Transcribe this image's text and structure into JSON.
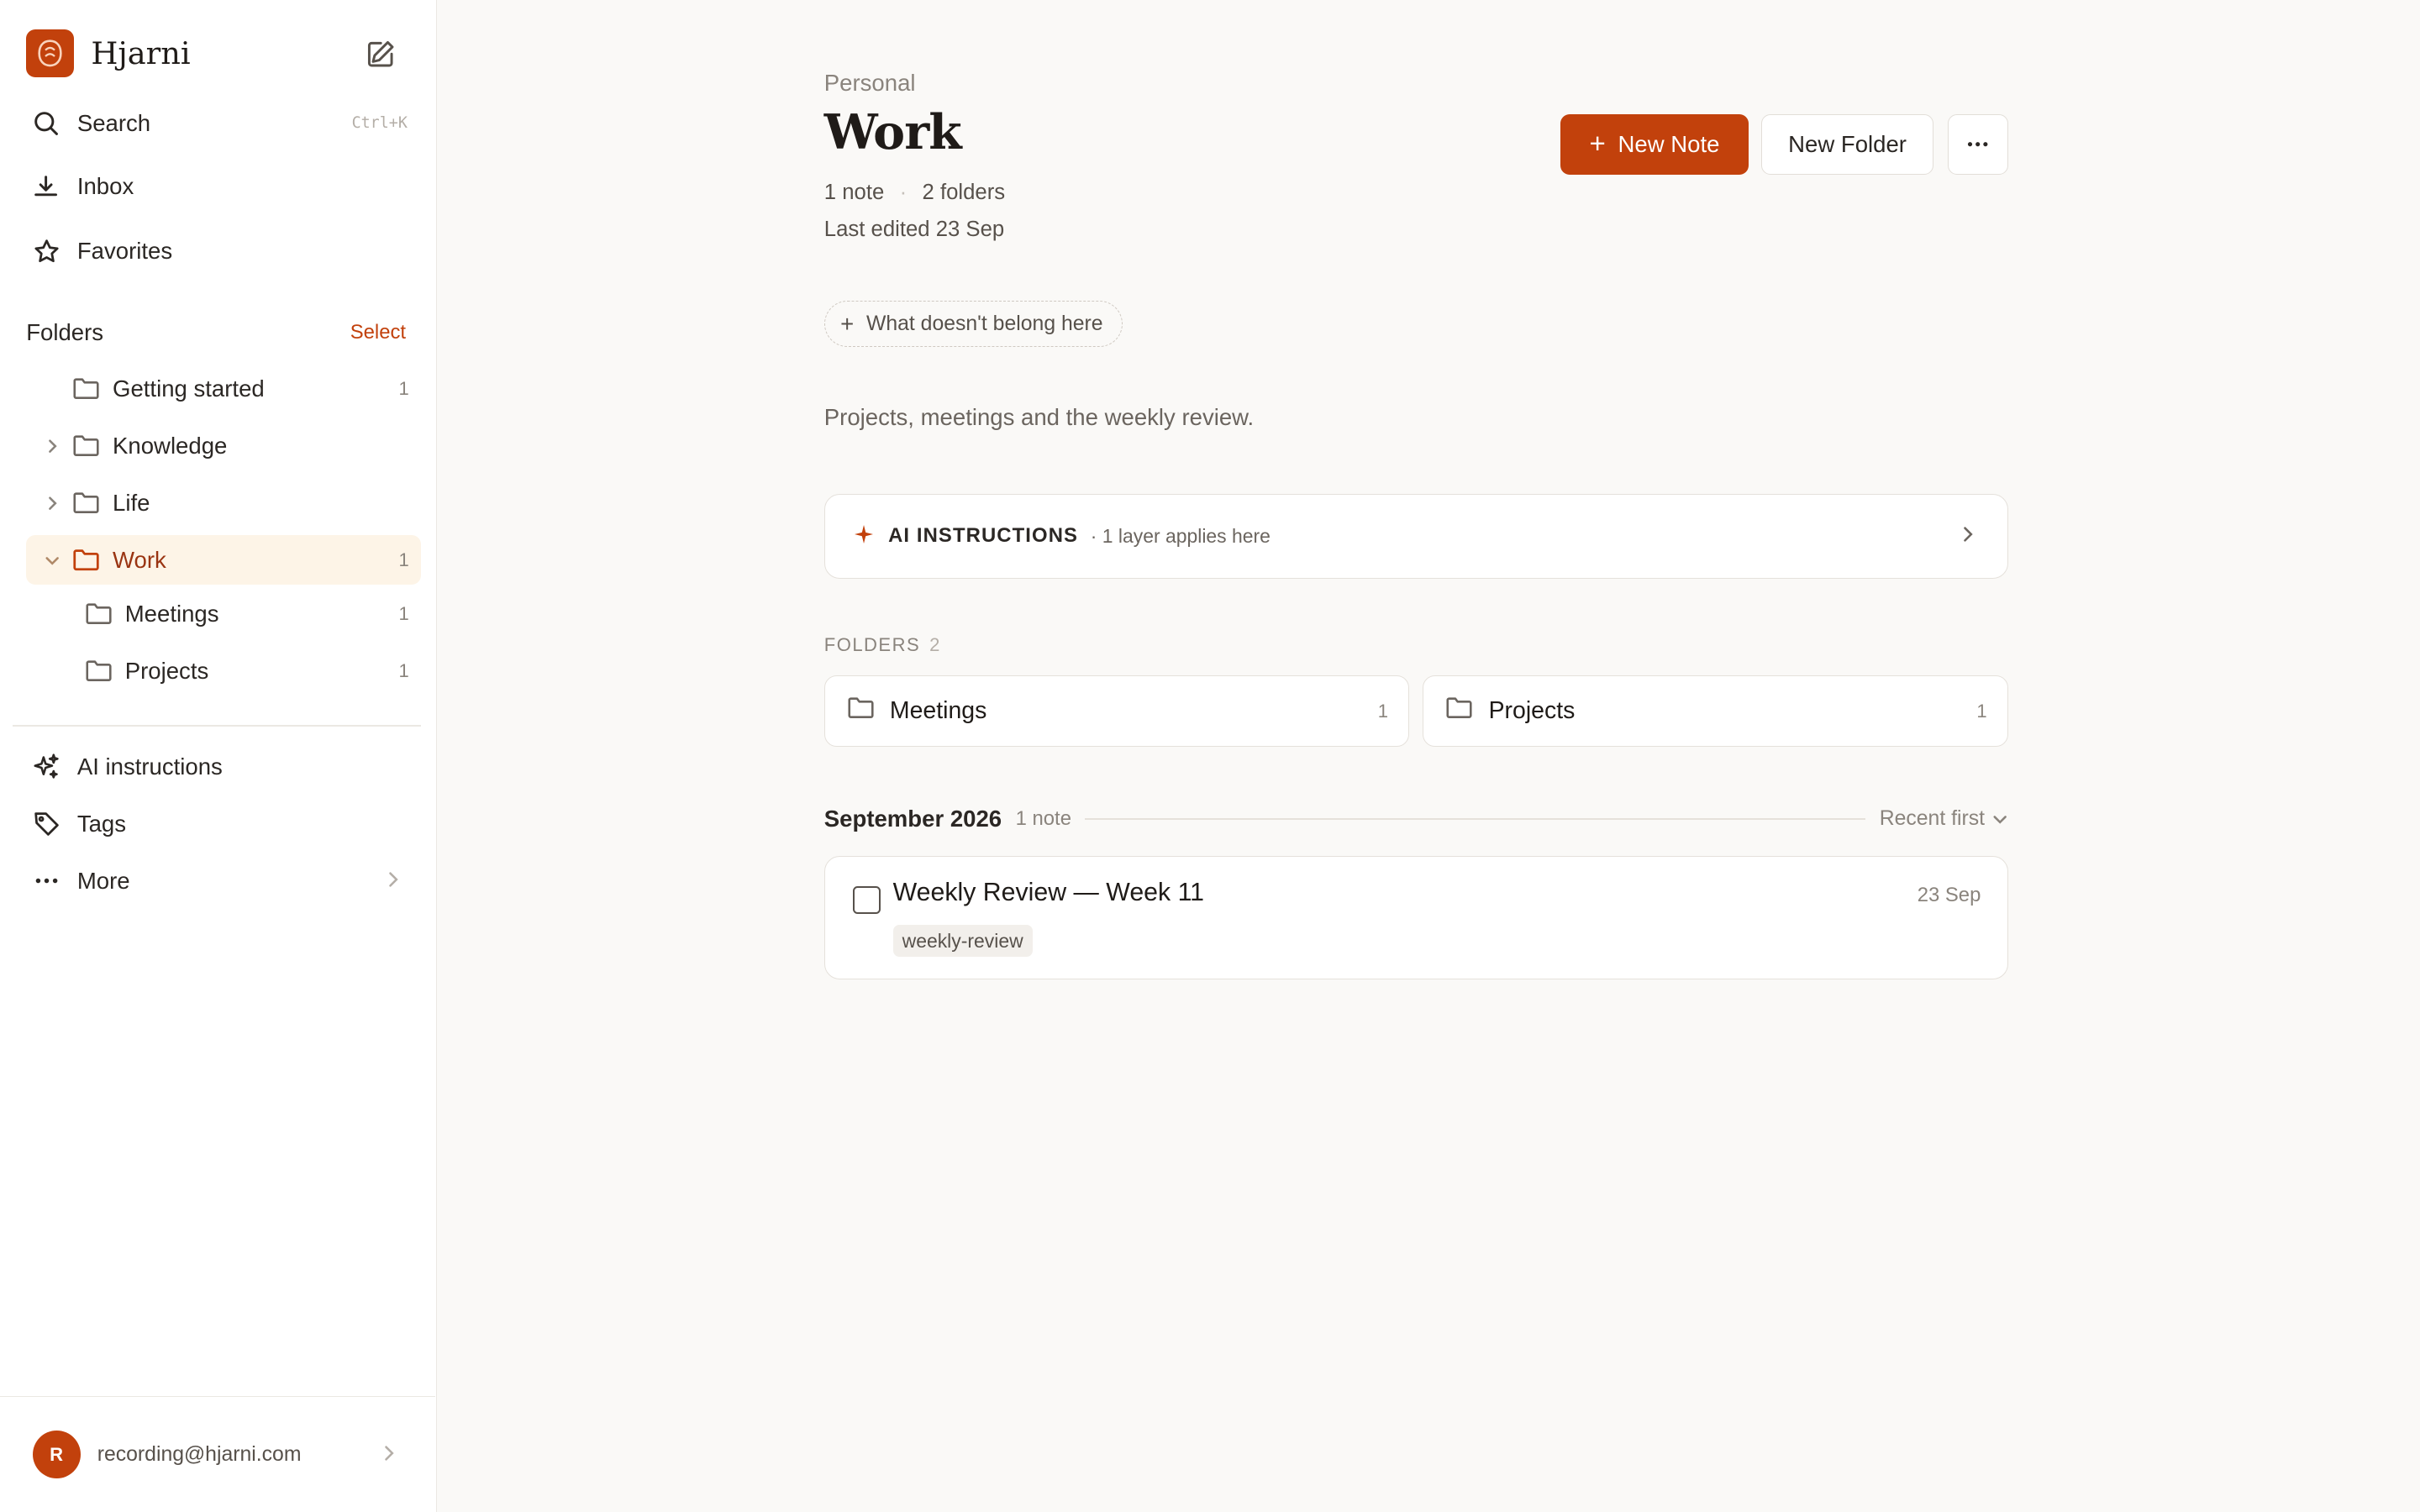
{
  "brand": {
    "name": "Hjarni"
  },
  "nav": {
    "search": {
      "label": "Search",
      "shortcut": "Ctrl+K"
    },
    "inbox": {
      "label": "Inbox"
    },
    "favorites": {
      "label": "Favorites"
    }
  },
  "folders_section": {
    "title": "Folders",
    "select_label": "Select",
    "items": [
      {
        "label": "Getting started",
        "count": "1"
      },
      {
        "label": "Knowledge",
        "count": ""
      },
      {
        "label": "Life",
        "count": ""
      },
      {
        "label": "Work",
        "count": "1"
      },
      {
        "label": "Meetings",
        "count": "1"
      },
      {
        "label": "Projects",
        "count": "1"
      }
    ]
  },
  "bottom_nav": {
    "ai": {
      "label": "AI instructions"
    },
    "tags": {
      "label": "Tags"
    },
    "more": {
      "label": "More"
    }
  },
  "account": {
    "initial": "R",
    "email": "recording@hjarni.com"
  },
  "main": {
    "breadcrumb": "Personal",
    "title": "Work",
    "meta": {
      "notes": "1 note",
      "folders": "2 folders"
    },
    "last_edited": "Last edited 23 Sep",
    "actions": {
      "new_note": "New Note",
      "new_folder": "New Folder"
    },
    "exclude_pill": "What doesn't belong here",
    "description": "Projects, meetings and the weekly review.",
    "ai_card": {
      "title": "AI INSTRUCTIONS",
      "subtitle": "· 1 layer applies here"
    },
    "folders_header": {
      "label": "FOLDERS",
      "count": "2"
    },
    "folder_cards": [
      {
        "label": "Meetings",
        "count": "1"
      },
      {
        "label": "Projects",
        "count": "1"
      }
    ],
    "group": {
      "month": "September 2026",
      "count": "1 note",
      "sort": "Recent first"
    },
    "notes": [
      {
        "title": "Weekly Review — Week 11",
        "date": "23 Sep",
        "tag": "weekly-review"
      }
    ]
  },
  "colors": {
    "accent": "#c2410c",
    "active_bg": "#fdf4e7"
  }
}
